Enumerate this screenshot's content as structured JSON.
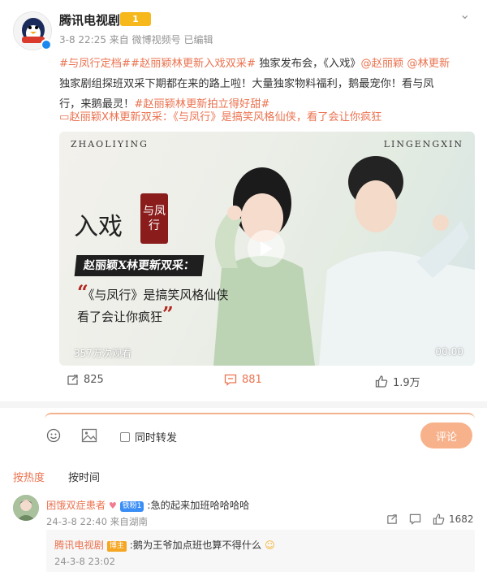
{
  "post": {
    "author": "腾讯电视剧",
    "author_badge": "1",
    "meta": "3-8 22:25 来自 微博视频号 已编辑",
    "line1_tag": "#与凤行定档##赵丽颖林更新入戏双采#",
    "line1_text": " 独家发布会，《入戏》",
    "mention1": "@赵丽颖",
    "mention2": " @林更新",
    "line2": "独家剧组探班双采下期都在来的路上啦！大量独家物料福利，鹅最宠你！看与凤",
    "line3_text": "行，来鹅最灵！",
    "line3_tag": "#赵丽颖林更新拍立得好甜#",
    "video_link": "赵丽颖X林更新双采：《与凤行》是搞笑风格仙侠，看了会让你疯狂"
  },
  "video": {
    "name_left": "ZHAOLIYING",
    "name_right": "LINGENGXIN",
    "title": "入戏",
    "seal": "与凤行",
    "banner": "赵丽颖X林更新双采：",
    "quote_line1": "《与凤行》是搞笑风格仙侠",
    "quote_line2": "看了会让你疯狂",
    "views": "357万次观看",
    "duration": "00:00"
  },
  "actions": {
    "repost_count": "825",
    "comment_count": "881",
    "like_count": "1.9万"
  },
  "composer": {
    "repost_label": "同时转发",
    "submit_label": "评论"
  },
  "sort": {
    "hot": "按热度",
    "time": "按时间"
  },
  "comment": {
    "name": "困饿双症患者",
    "fan_badge": "铁粉1",
    "text": ":急的起来加班哈哈哈哈",
    "meta": "24-3-8 22:40 来自湖南",
    "like_count": "1682"
  },
  "reply": {
    "name": "腾讯电视剧",
    "badge": "博主",
    "text": ":鹅为王爷加点班也算不得什么",
    "meta": "24-3-8 23:02"
  },
  "colors": {
    "accent": "#eb7350",
    "button": "#f7b28c",
    "link": "#eb7350"
  }
}
